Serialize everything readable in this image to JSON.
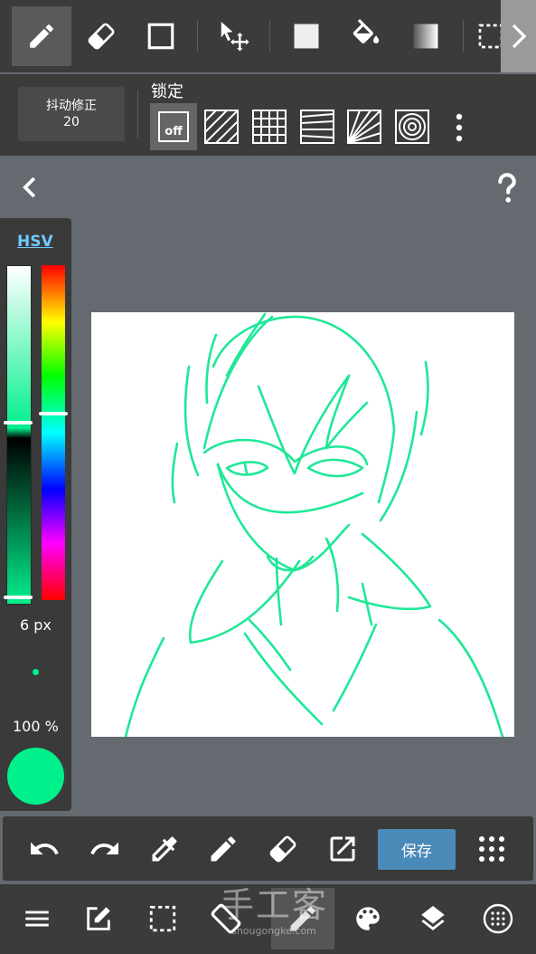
{
  "top_toolbar": {
    "tools": [
      "pen-tool",
      "eraser-tool",
      "shape-tool",
      "move-tool",
      "fill-color",
      "bucket-tool",
      "gradient-tool",
      "select-tool"
    ]
  },
  "second_toolbar": {
    "stabilizer_label": "抖动修正",
    "stabilizer_value": "20",
    "lock_label": "锁定",
    "lock_off": "off"
  },
  "color_panel": {
    "mode": "HSV",
    "brush_size": "6 px",
    "opacity": "100 %",
    "current_color": "#00f08c"
  },
  "bottom_toolbar": {
    "save_label": "保存"
  },
  "watermark": {
    "text": "手工客",
    "sub": "shougongke.com"
  },
  "colors": {
    "stroke": "#1ee896",
    "accent_save": "#4a8ab8",
    "hsv_link": "#6fc8ff"
  }
}
